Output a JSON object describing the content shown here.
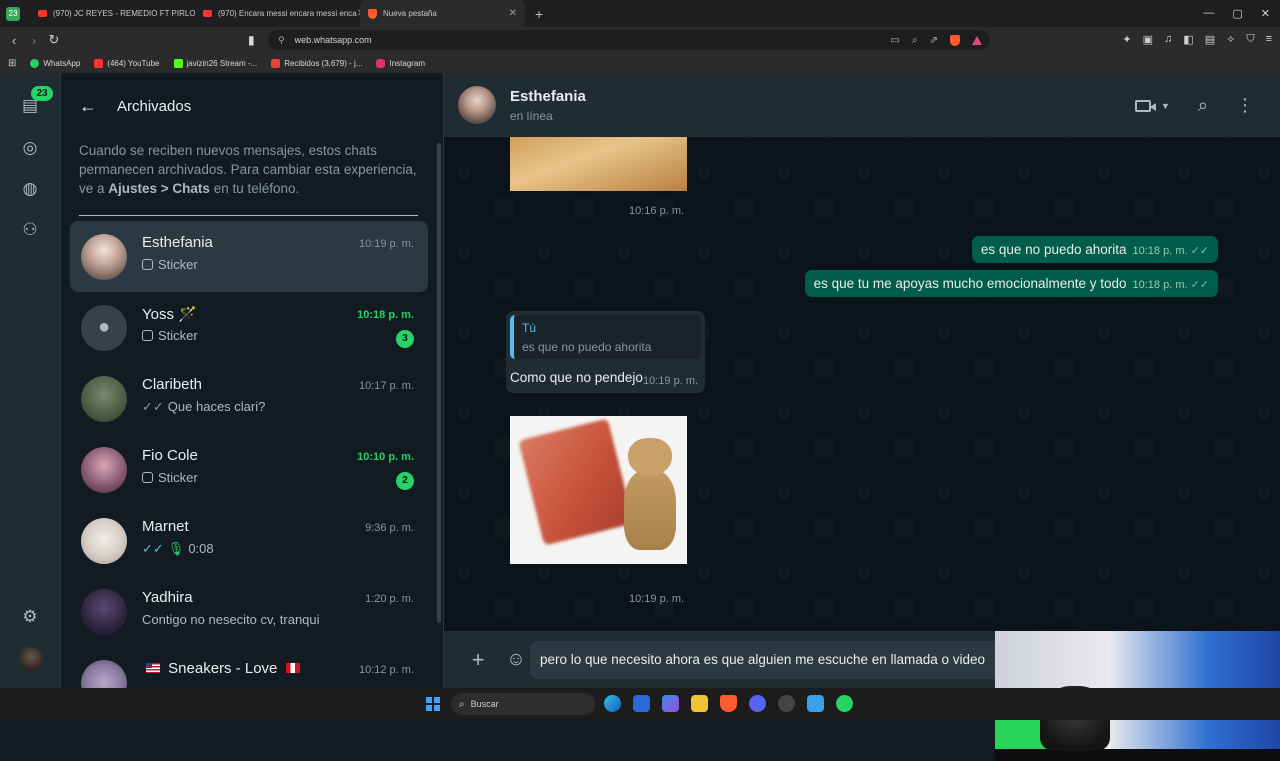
{
  "browser": {
    "window_badge": "23",
    "tabs": [
      {
        "title": "(970) JC REYES - REMEDIO FT PIRLO",
        "icon": "youtube-icon"
      },
      {
        "title": "(970) Encara messi encara messi enca",
        "icon": "youtube-icon"
      },
      {
        "title": "Nueva pestaña",
        "icon": "brave-icon"
      }
    ],
    "new_tab": "+",
    "url": "web.whatsapp.com",
    "bookmarks": [
      {
        "label": "WhatsApp",
        "color": "#25d366"
      },
      {
        "label": "(464) YouTube",
        "color": "#ff3333"
      },
      {
        "label": "javizin26 Stream -...",
        "color": "#53fc18"
      },
      {
        "label": "Recibidos (3,679) - j...",
        "color": "#ea4335"
      },
      {
        "label": "Instagram",
        "color": "#e1306c"
      }
    ]
  },
  "rail": {
    "chats_badge": "23"
  },
  "sidebar": {
    "title": "Archivados",
    "notice_part1": "Cuando se reciben nuevos mensajes, estos chats permanecen archivados. Para cambiar esta experiencia, ve a ",
    "notice_bold": "Ajustes > Chats",
    "notice_part2": " en tu teléfono.",
    "chats": [
      {
        "name": "Esthefania",
        "time": "10:19 p. m.",
        "preview": "Sticker",
        "type": "sticker"
      },
      {
        "name": "Yoss",
        "name_suffix": "🪄",
        "time": "10:18 p. m.",
        "preview": "Sticker",
        "type": "sticker",
        "unread": "3"
      },
      {
        "name": "Claribeth",
        "time": "10:17 p. m.",
        "preview": "Que haces clari?",
        "type": "sent"
      },
      {
        "name": "Fio Cole",
        "time": "10:10 p. m.",
        "preview": "Sticker",
        "type": "sticker",
        "unread": "2"
      },
      {
        "name": "Marnet",
        "time": "9:36 p. m.",
        "preview": "0:08",
        "type": "audio"
      },
      {
        "name": "Yadhira",
        "time": "1:20 p. m.",
        "preview": "Contigo no nesecito cv, tranqui",
        "type": "text"
      },
      {
        "name": "Sneakers  - Love",
        "time": "10:12 p. m.",
        "preview": "",
        "type": "text"
      }
    ]
  },
  "conversation": {
    "contact_name": "Esthefania",
    "status": "en línea",
    "messages": [
      {
        "time": "10:16 p. m."
      },
      {
        "text": "es que no puedo ahorita",
        "time": "10:18 p. m."
      },
      {
        "text": "es que tu me apoyas mucho emocionalmente y todo",
        "time": "10:18 p. m."
      },
      {
        "quote_author": "Tú",
        "quote_text": "es que no puedo ahorita",
        "text": "Como que no pendejo",
        "time": "10:19 p. m."
      },
      {
        "time": "10:19 p. m."
      }
    ],
    "composer_text": "pero lo que necesito ahora es que alguien me escuche en llamada o video"
  },
  "taskbar": {
    "search_label": "Buscar"
  }
}
